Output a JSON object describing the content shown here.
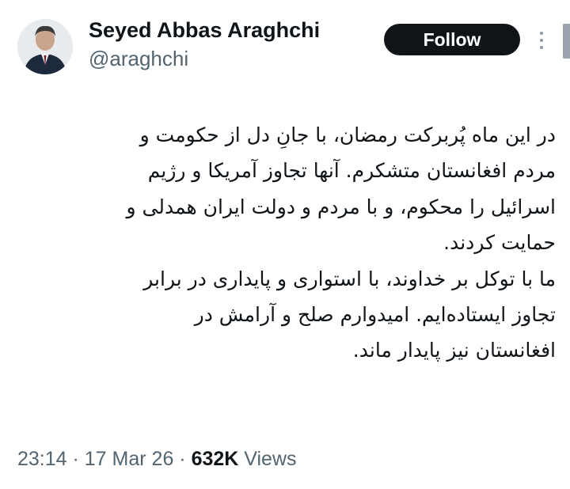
{
  "author": {
    "display_name": "Seyed Abbas Araghchi",
    "handle": "@araghchi",
    "avatar_icon": "user-avatar-photo"
  },
  "actions": {
    "follow_label": "Follow",
    "more_icon": "more-vertical-icon"
  },
  "tweet": {
    "direction": "rtl",
    "lines": [
      "در این ماه پُربرکت رمضان، با جانِ دل از حکومت و",
      "مردم افغانستان متشکرم. آنها تجاوز آمریکا و رژیم",
      "اسرائیل را محکوم، و با مردم و دولت ایران همدلی و",
      "حمایت کردند.",
      "ما با توکل بر خداوند، با استواری و پایداری در برابر",
      "تجاوز ایستاده‌ایم. امیدوارم صلح و آرامش در",
      "افغانستان نیز پایدار ماند."
    ]
  },
  "meta": {
    "time": "23:14",
    "separator": " · ",
    "date": "17 Mar 26",
    "views_count": "632K",
    "views_label": "Views"
  },
  "colors": {
    "text_primary": "#0f1419",
    "text_secondary": "#536471",
    "follow_bg": "#0f1419",
    "follow_text": "#ffffff",
    "background": "#ffffff"
  }
}
